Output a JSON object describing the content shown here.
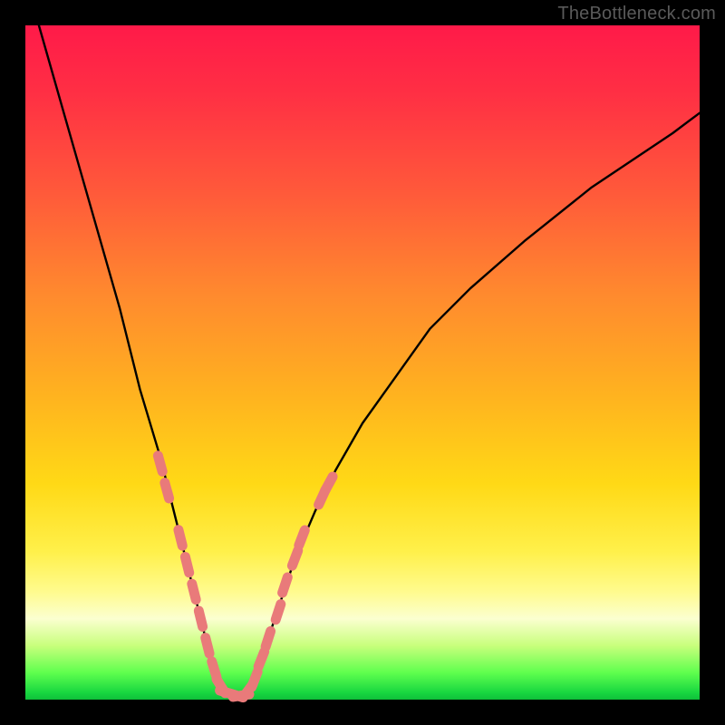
{
  "watermark": "TheBottleneck.com",
  "chart_data": {
    "type": "line",
    "title": "",
    "xlabel": "",
    "ylabel": "",
    "xlim": [
      0,
      100
    ],
    "ylim": [
      0,
      100
    ],
    "grid": false,
    "legend": false,
    "series": [
      {
        "name": "bottleneck-curve",
        "x": [
          2,
          6,
          10,
          14,
          17,
          20,
          22,
          24,
          25.5,
          27,
          28,
          29,
          30,
          32,
          33,
          34.5,
          36,
          38,
          40,
          43,
          46,
          50,
          55,
          60,
          66,
          74,
          84,
          96,
          100
        ],
        "y": [
          100,
          86,
          72,
          58,
          46,
          36,
          28,
          20,
          14,
          8,
          4,
          1.5,
          0.8,
          0.6,
          1.3,
          4,
          9,
          15,
          21,
          28,
          34,
          41,
          48,
          55,
          61,
          68,
          76,
          84,
          87
        ],
        "color": "#000000",
        "style": "solid"
      }
    ],
    "markers": [
      {
        "name": "left-branch-dots",
        "color": "#e97a7a",
        "shape": "pill",
        "points": [
          {
            "x": 20.0,
            "y": 35
          },
          {
            "x": 21.0,
            "y": 31
          },
          {
            "x": 23.0,
            "y": 24
          },
          {
            "x": 24.0,
            "y": 20
          },
          {
            "x": 25.0,
            "y": 16
          },
          {
            "x": 26.0,
            "y": 12
          },
          {
            "x": 27.0,
            "y": 8
          },
          {
            "x": 28.0,
            "y": 4.5
          },
          {
            "x": 29.0,
            "y": 2
          },
          {
            "x": 30.0,
            "y": 1
          },
          {
            "x": 31.0,
            "y": 0.7
          },
          {
            "x": 32.0,
            "y": 0.6
          }
        ]
      },
      {
        "name": "right-branch-dots",
        "color": "#e97a7a",
        "shape": "pill",
        "points": [
          {
            "x": 33.0,
            "y": 1.3
          },
          {
            "x": 34.0,
            "y": 3
          },
          {
            "x": 35.0,
            "y": 6
          },
          {
            "x": 36.0,
            "y": 9
          },
          {
            "x": 37.5,
            "y": 13
          },
          {
            "x": 38.5,
            "y": 17
          },
          {
            "x": 40.0,
            "y": 21
          },
          {
            "x": 41.0,
            "y": 24
          },
          {
            "x": 44.0,
            "y": 30
          },
          {
            "x": 45.0,
            "y": 32
          }
        ]
      }
    ],
    "colors": {
      "gradient_top": "#ff1a49",
      "gradient_mid1": "#ff8a2e",
      "gradient_mid2": "#ffd916",
      "gradient_low": "#fbffd0",
      "gradient_bottom": "#17d640",
      "curve": "#000000",
      "markers": "#e97a7a",
      "frame": "#000000"
    }
  }
}
